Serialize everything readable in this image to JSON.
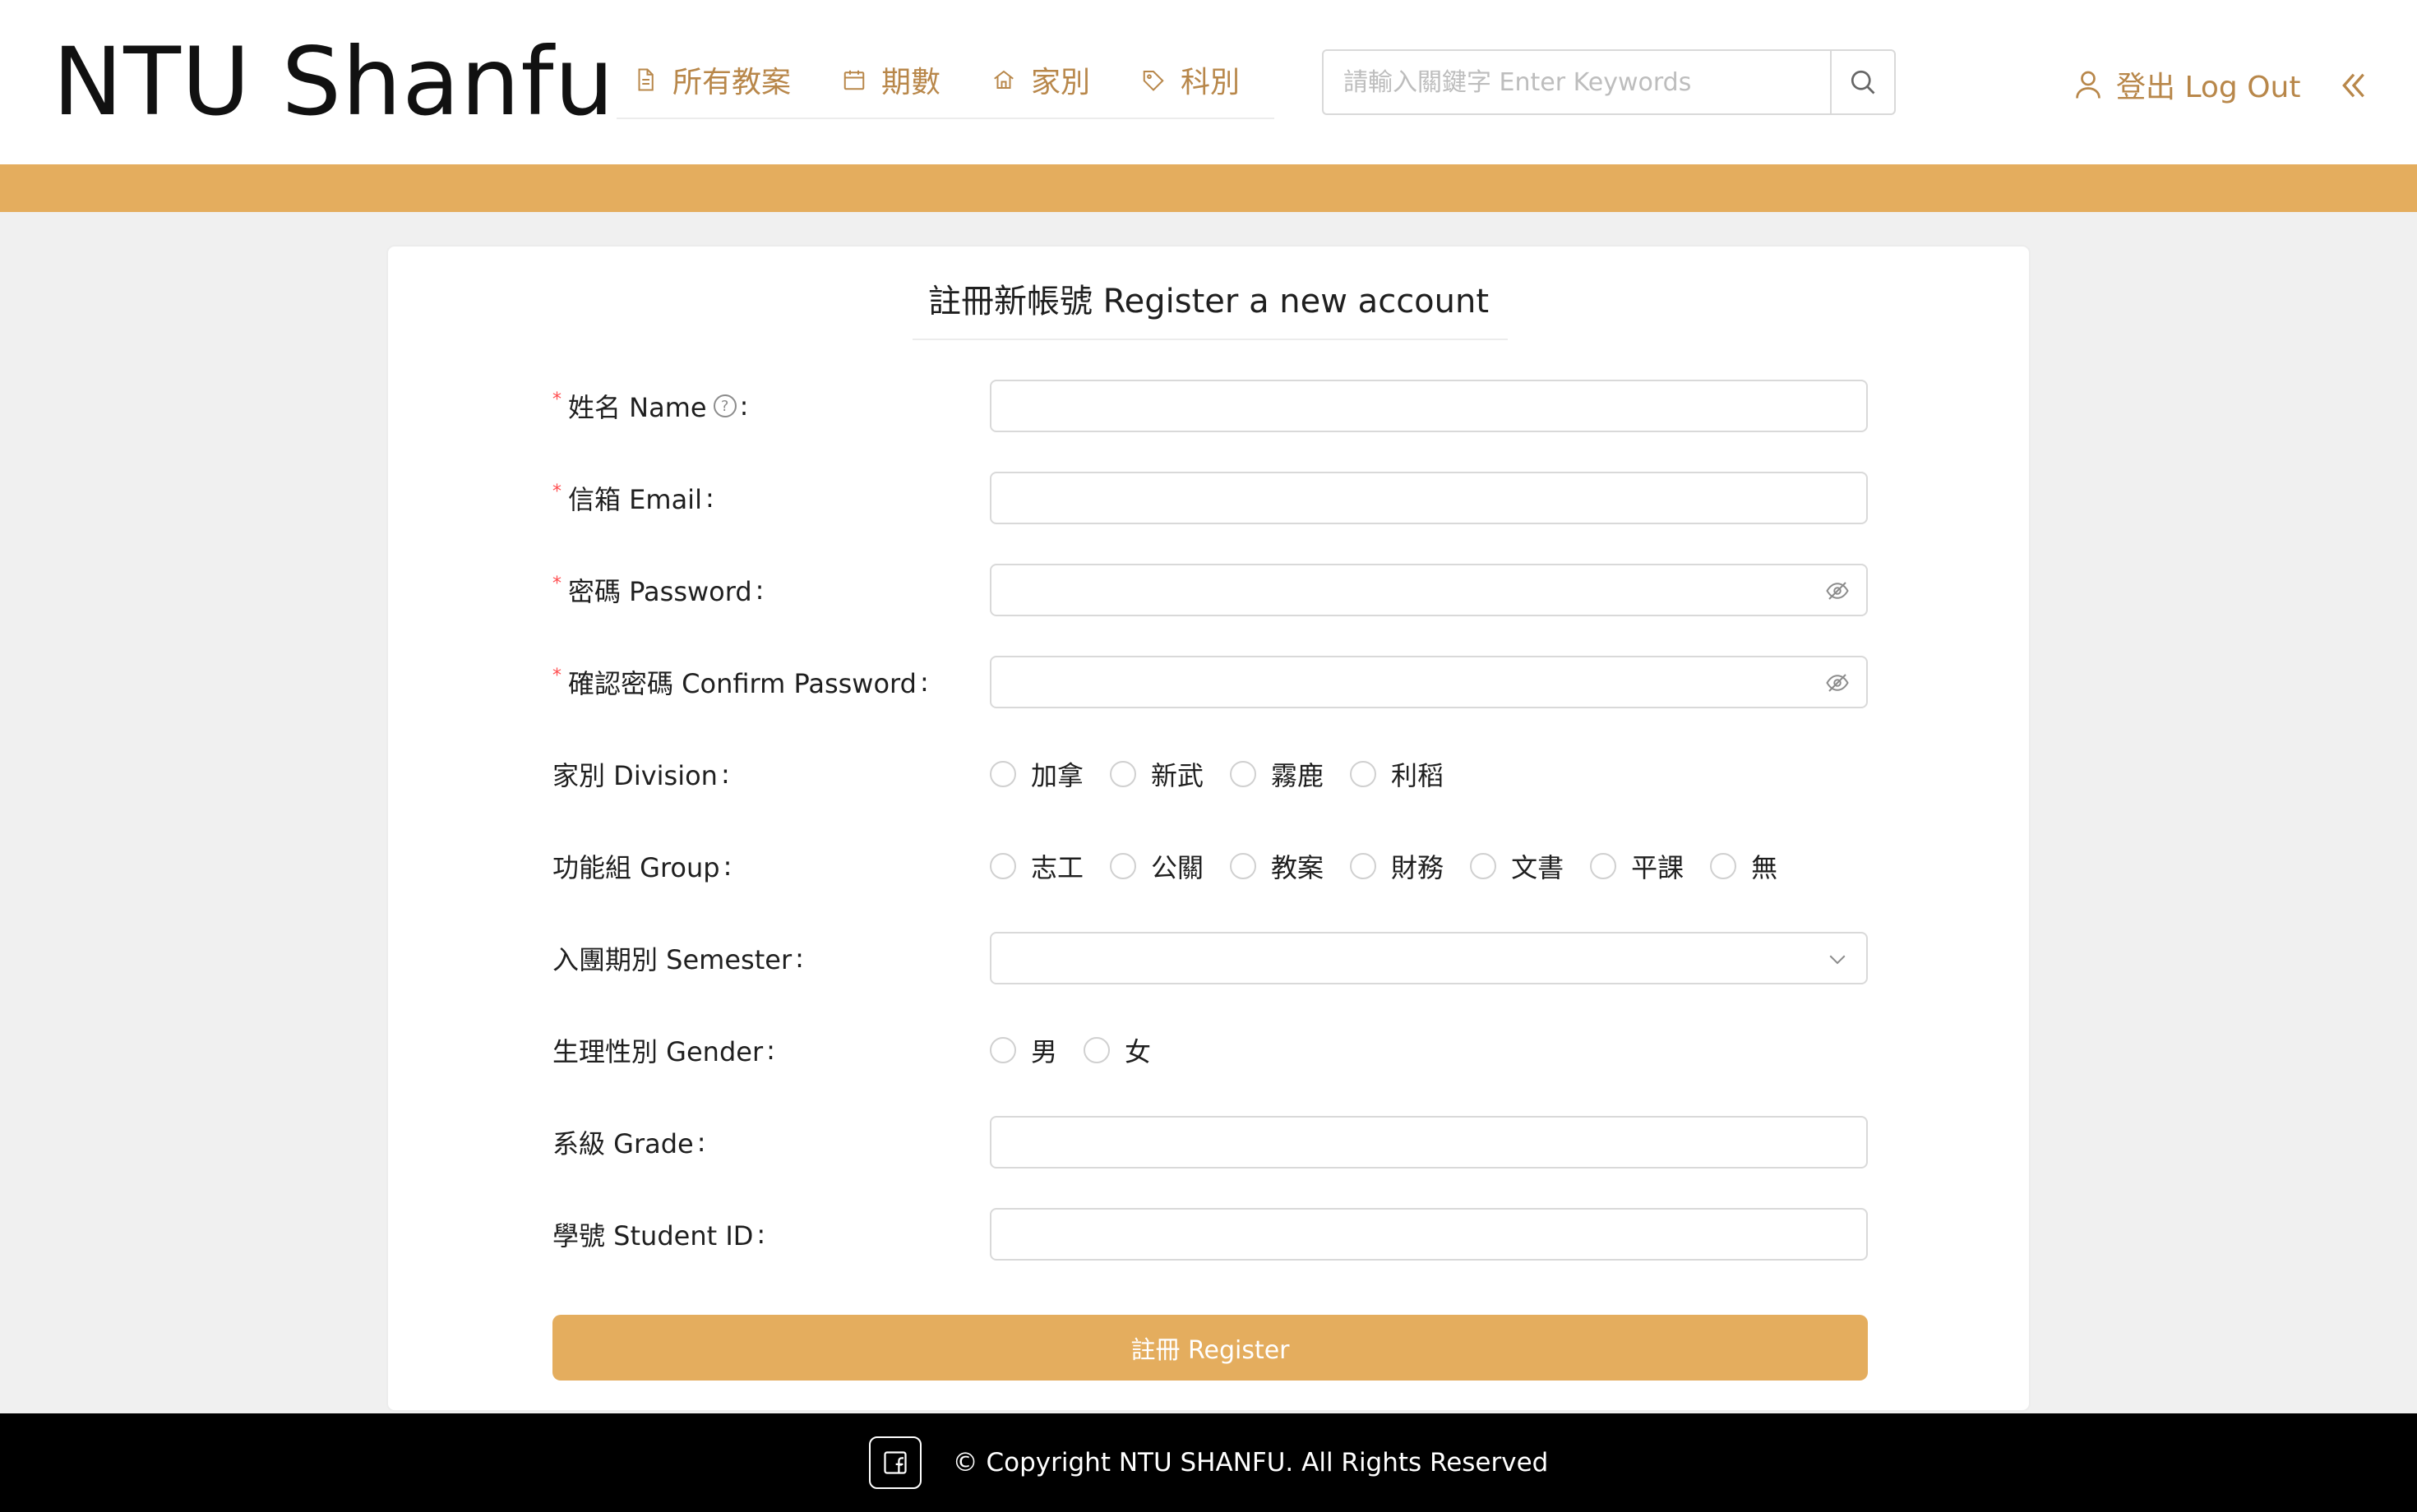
{
  "header": {
    "logo": "NTU Shanfu",
    "nav": [
      {
        "label": "所有教案",
        "icon": "document-icon"
      },
      {
        "label": "期數",
        "icon": "calendar-icon"
      },
      {
        "label": "家別",
        "icon": "home-icon"
      },
      {
        "label": "科別",
        "icon": "tag-icon"
      }
    ],
    "search": {
      "placeholder": "請輸入關鍵字 Enter Keywords",
      "value": "",
      "icon": "search-icon"
    },
    "logout": {
      "label": "登出 Log Out",
      "icon": "user-icon"
    },
    "collapse_icon": "double-chevron-left-icon"
  },
  "colors": {
    "accent": "#e4ad5e",
    "nav_text": "#b8874a",
    "required": "#ff4d4f",
    "footer_bg": "#000000"
  },
  "form": {
    "title": "註冊新帳號 Register a new account",
    "fields": {
      "name": {
        "label": "姓名 Name",
        "required": "*",
        "help": "?",
        "value": ""
      },
      "email": {
        "label": "信箱 Email",
        "required": "*",
        "value": ""
      },
      "password": {
        "label": "密碼 Password",
        "required": "*",
        "value": "",
        "icon": "eye-invisible-icon"
      },
      "confirm_password": {
        "label": "確認密碼 Confirm Password",
        "required": "*",
        "value": "",
        "icon": "eye-invisible-icon"
      },
      "division": {
        "label": "家別 Division",
        "options": [
          "加拿",
          "新武",
          "霧鹿",
          "利稻"
        ]
      },
      "group": {
        "label": "功能組 Group",
        "options": [
          "志工",
          "公關",
          "教案",
          "財務",
          "文書",
          "平課",
          "無"
        ]
      },
      "semester": {
        "label": "入團期別 Semester",
        "value": "",
        "icon": "chevron-down-icon"
      },
      "gender": {
        "label": "生理性別 Gender",
        "options": [
          "男",
          "女"
        ]
      },
      "grade": {
        "label": "系級 Grade",
        "value": ""
      },
      "student_id": {
        "label": "學號 Student ID",
        "value": ""
      }
    },
    "colon": ":",
    "submit_label": "註冊 Register"
  },
  "footer": {
    "social_icon": "facebook-icon",
    "copyright": "© Copyright NTU SHANFU. All Rights Reserved"
  }
}
